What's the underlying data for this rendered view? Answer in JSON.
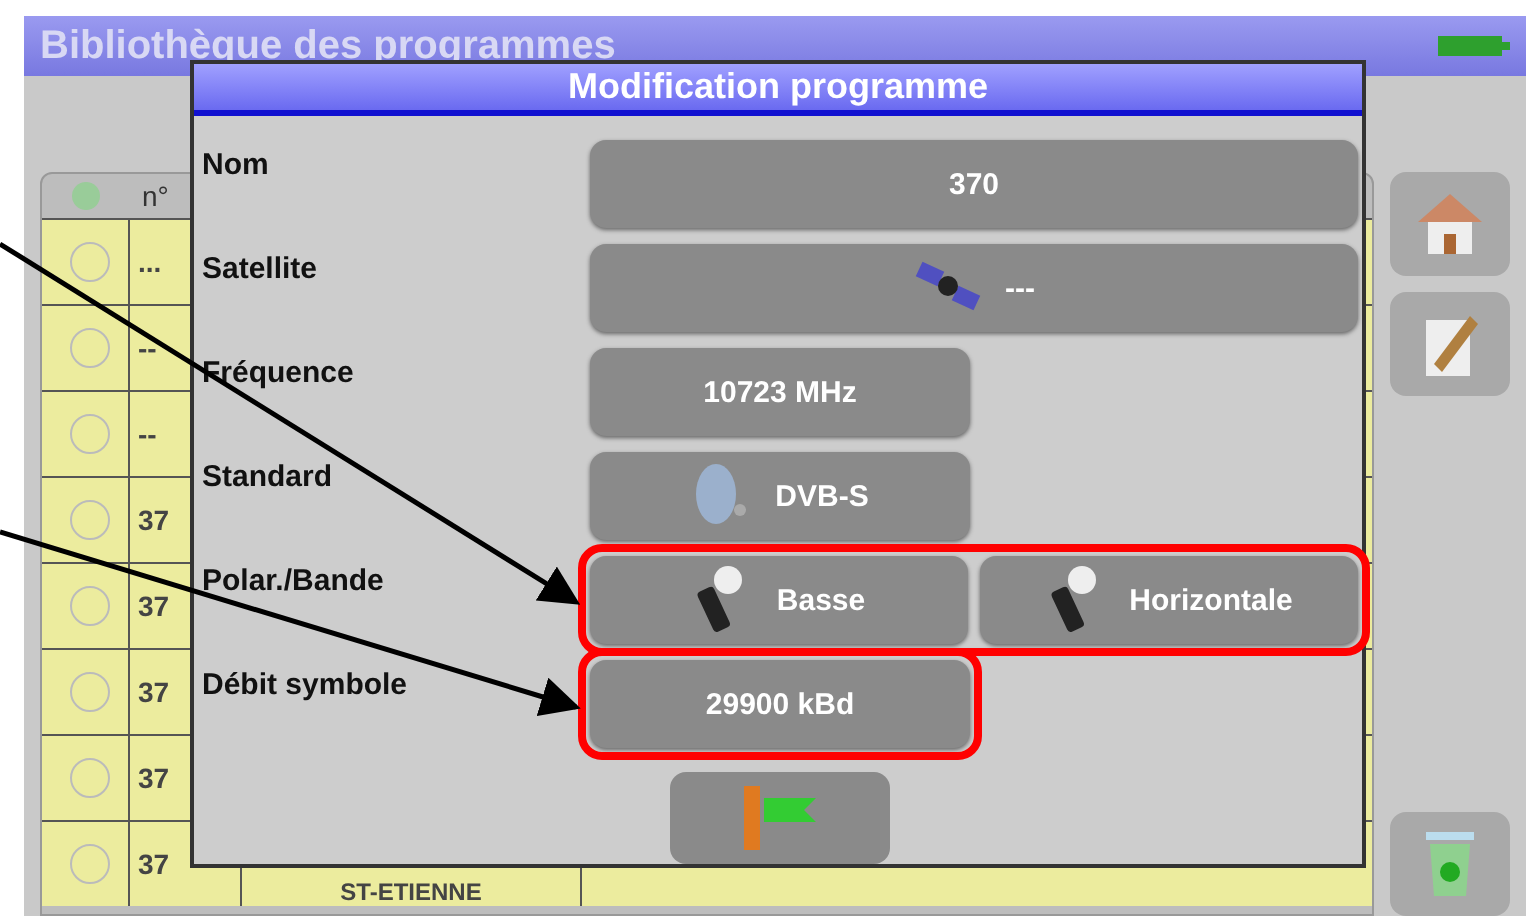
{
  "header": {
    "title": "Bibliothèque des programmes"
  },
  "table": {
    "columns": [
      "n°"
    ],
    "rows": [
      {
        "number": "...",
        "selected": false
      },
      {
        "number": "--",
        "selected": false
      },
      {
        "number": "--",
        "selected": false
      },
      {
        "number": "37",
        "selected": false
      },
      {
        "number": "37",
        "selected": false
      },
      {
        "number": "37",
        "selected": false
      },
      {
        "number": "37",
        "selected": false
      },
      {
        "number": "37",
        "selected": false,
        "name": "ST-ETIENNE"
      }
    ]
  },
  "dialog": {
    "title": "Modification programme",
    "fields": [
      {
        "label": "Nom",
        "kind": "name",
        "highlighted": false,
        "buttons": [
          "370"
        ]
      },
      {
        "label": "Satellite",
        "kind": "satellite",
        "highlighted": false,
        "buttons": [
          "---"
        ]
      },
      {
        "label": "Fréquence",
        "kind": "frequency",
        "highlighted": false,
        "buttons": [
          "10723 MHz"
        ]
      },
      {
        "label": "Standard",
        "kind": "standard",
        "highlighted": false,
        "buttons": [
          "DVB-S"
        ]
      },
      {
        "label": "Polar./Bande",
        "kind": "polarization",
        "highlighted": true,
        "buttons": [
          "Basse",
          "Horizontale"
        ]
      },
      {
        "label": "Débit symbole",
        "kind": "rate",
        "highlighted": true,
        "buttons": [
          "29900 kBd"
        ]
      }
    ]
  }
}
